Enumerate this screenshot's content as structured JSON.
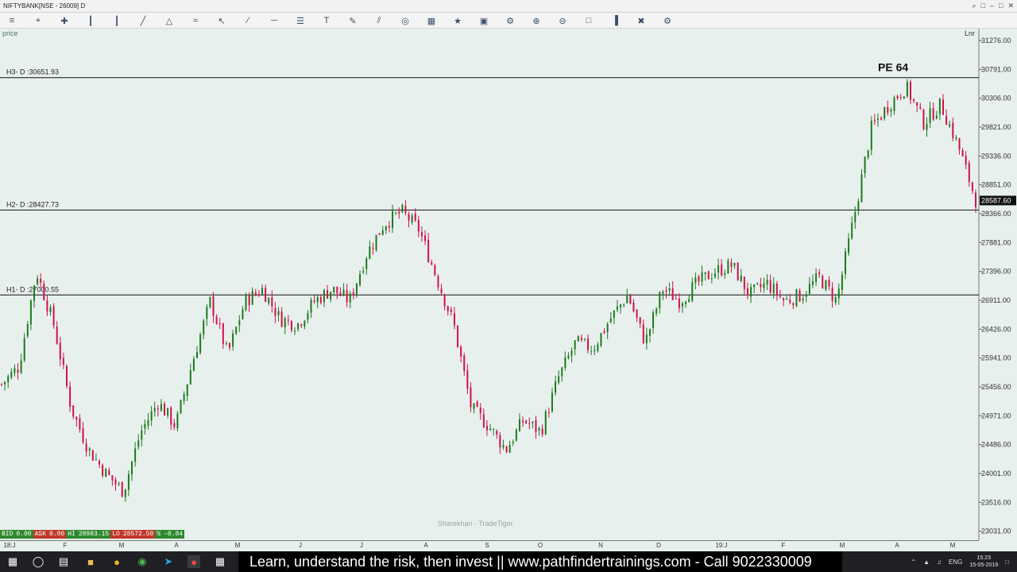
{
  "window": {
    "title": "NIFTYBANK[NSE - 26009] D",
    "controls": [
      "⌕",
      "□",
      "–",
      "□",
      "✕"
    ]
  },
  "toolbar": {
    "icons": [
      "chart-type-icon",
      "zoom-icon",
      "crosshair-icon",
      "bar-chart-icon",
      "candle-icon",
      "line-icon",
      "area-icon",
      "indicator-icon",
      "pointer-icon",
      "trendline-icon",
      "hline-icon",
      "fib-icon",
      "text-icon",
      "brush-icon",
      "ruler-icon",
      "alert-icon",
      "template-icon",
      "star-icon",
      "layout-icon",
      "settings-icon",
      "zoom-in-icon",
      "zoom-out-icon",
      "fit-icon",
      "histogram-icon",
      "delete-icon",
      "gear-icon"
    ]
  },
  "chart": {
    "panel_label": "price",
    "scale_label": "Lnr",
    "watermark": "Sharekhan - TradeTiger",
    "annotation": "PE 64",
    "current_price": "28587.60"
  },
  "chart_data": {
    "type": "candlestick",
    "title": "NIFTYBANK[NSE - 26009] D",
    "y_ticks": [
      "31276.00",
      "30791.00",
      "30306.00",
      "29821.00",
      "29336.00",
      "28851.00",
      "28366.00",
      "27881.00",
      "27396.00",
      "26911.00",
      "26426.00",
      "25941.00",
      "25456.00",
      "24971.00",
      "24486.00",
      "24001.00",
      "23516.00",
      "23031.00"
    ],
    "x_ticks": [
      "18:J",
      "F",
      "M",
      "A",
      "M",
      "J",
      "J",
      "A",
      "S",
      "O",
      "N",
      "D",
      "19:J",
      "F",
      "M",
      "A",
      "M"
    ],
    "ylim": [
      22880,
      31476
    ],
    "hlines": [
      {
        "label": "H3- D :30651.93",
        "value": 30651.93
      },
      {
        "label": "H2- D :28427.73",
        "value": 28427.73
      },
      {
        "label": "H1- D :27000.55",
        "value": 27000.55
      }
    ],
    "grid": false,
    "close_path": [
      25500,
      25800,
      27400,
      26500,
      25100,
      24400,
      24000,
      23700,
      24700,
      25200,
      24800,
      25900,
      26900,
      26000,
      26900,
      27100,
      26600,
      26500,
      26900,
      27100,
      26900,
      27700,
      28200,
      28400,
      28100,
      27300,
      26500,
      25100,
      24800,
      24400,
      24900,
      24700,
      25600,
      26200,
      26100,
      26600,
      27000,
      26200,
      27100,
      26900,
      27200,
      27400,
      27500,
      27000,
      27200,
      26900,
      27000,
      27300,
      26900,
      28300,
      29800,
      30200,
      30500,
      29900,
      30200,
      29500,
      28600
    ]
  },
  "status": {
    "bid_label": "BID",
    "bid_value": "0.00",
    "ask_label": "ASK",
    "ask_value": "0.00",
    "hi_label": "HI",
    "hi_value": "28983.15",
    "lo_label": "LO",
    "lo_value": "28572.50",
    "pct_label": "%",
    "pct_value": "-0.84"
  },
  "taskbar": {
    "ticker": "Learn, understand the risk, then invest || www.pathfindertrainings.com - Call 9022330009",
    "lang": "ENG",
    "time": "15:23",
    "date": "15-05-2019"
  }
}
